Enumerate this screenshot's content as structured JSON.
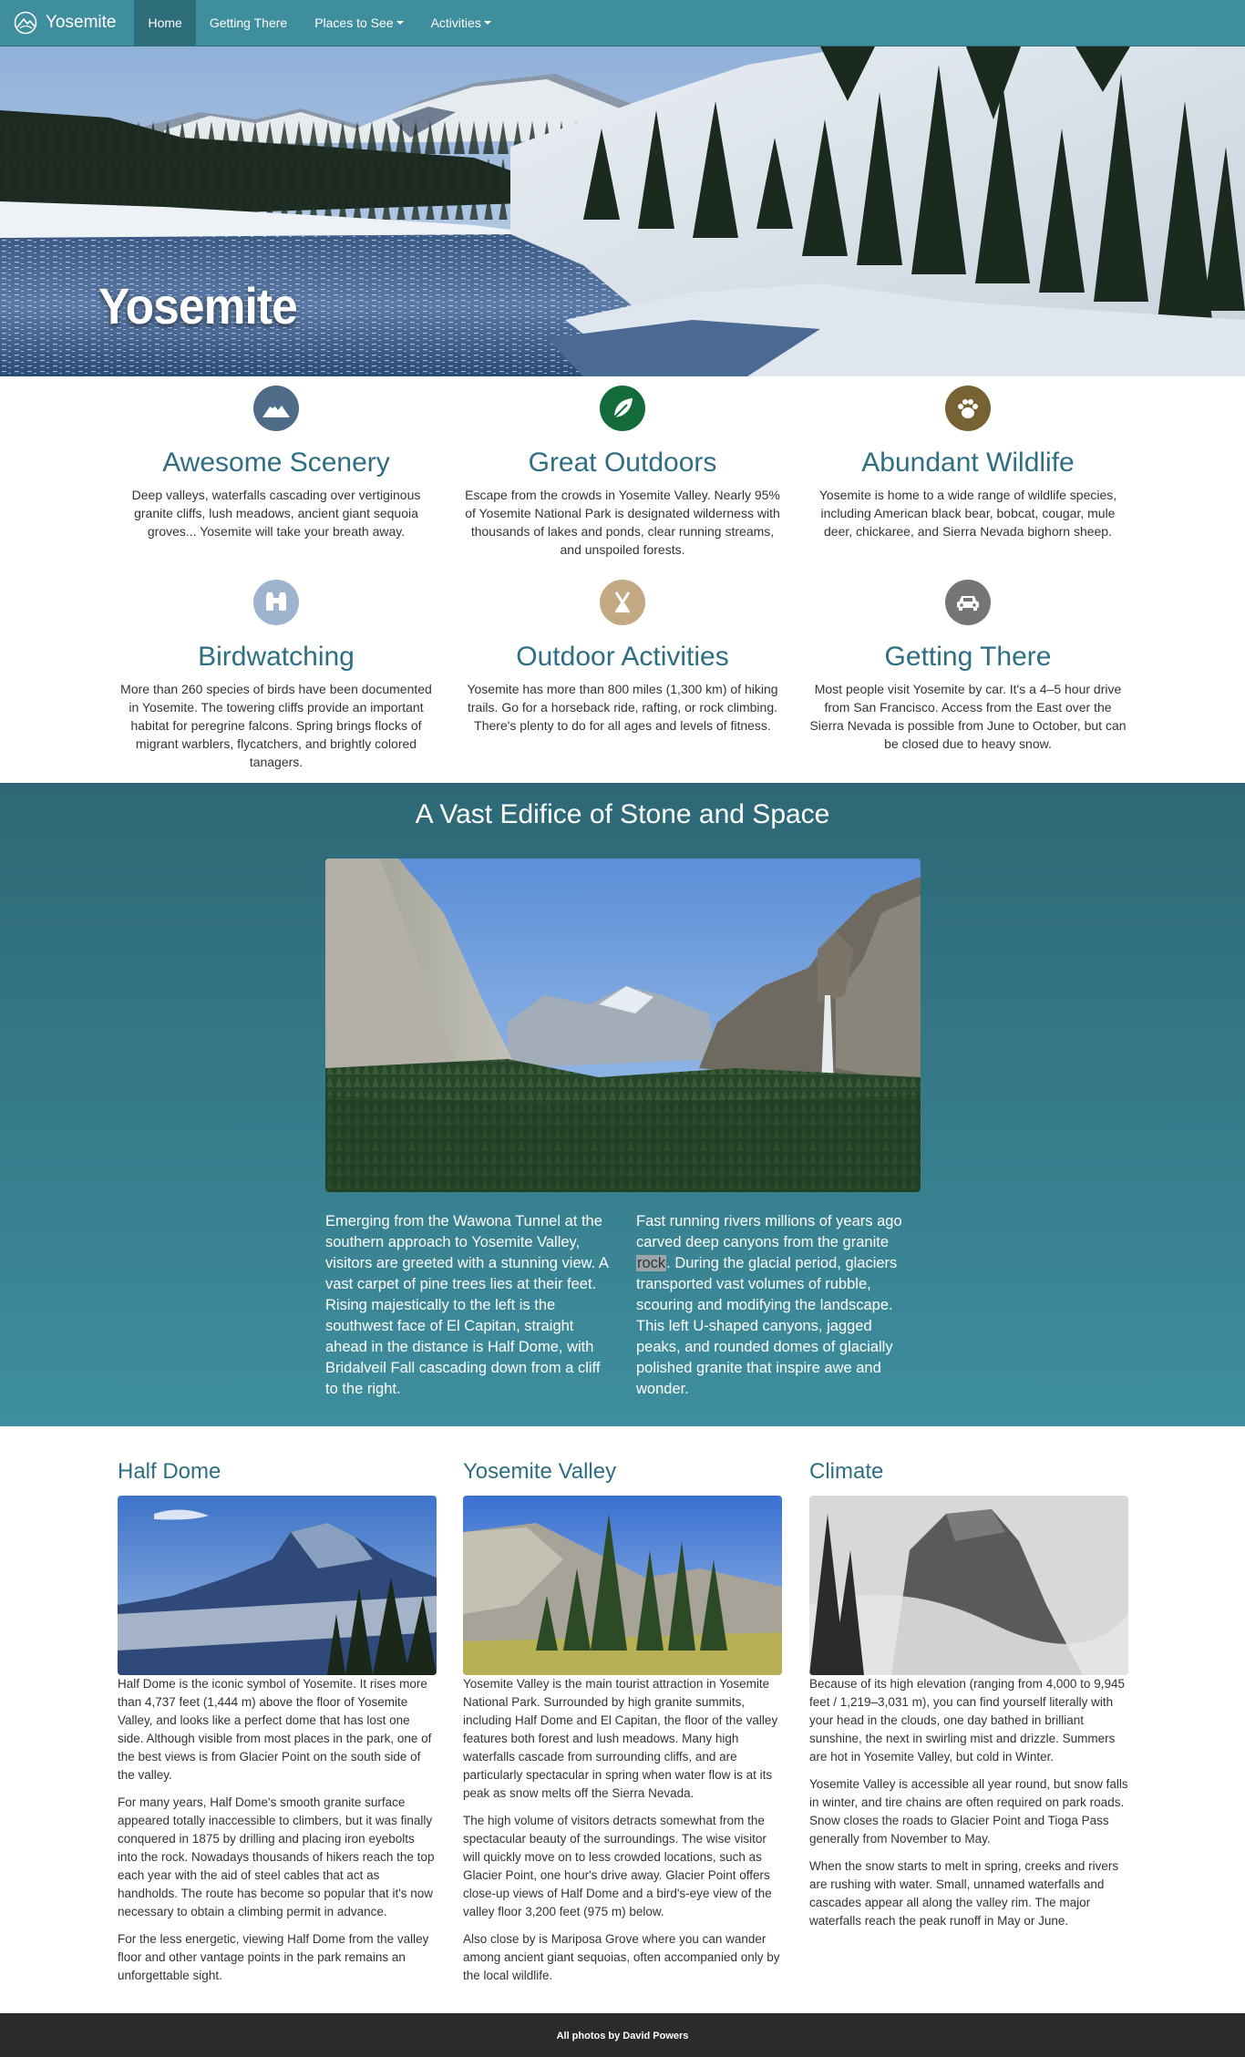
{
  "navbar": {
    "brand": "Yosemite",
    "items": [
      {
        "label": "Home"
      },
      {
        "label": "Getting There"
      },
      {
        "label": "Places to See"
      },
      {
        "label": "Activities"
      }
    ]
  },
  "hero": {
    "title": "Yosemite"
  },
  "features": [
    {
      "icon": "mountain-icon",
      "color": "#4e6c88",
      "title": "Awesome Scenery",
      "text": "Deep valleys, waterfalls cascading over vertiginous granite cliffs, lush meadows, ancient giant sequoia groves... Yosemite will take your breath away."
    },
    {
      "icon": "leaf-icon",
      "color": "#146b3a",
      "title": "Great Outdoors",
      "text": "Escape from the crowds in Yosemite Valley. Nearly 95% of Yosemite National Park is designated wilderness with thousands of lakes and ponds, clear running streams, and unspoiled forests."
    },
    {
      "icon": "paw-icon",
      "color": "#776233",
      "title": "Abundant Wildlife",
      "text": "Yosemite is home to a wide range of wildlife species, including American black bear, bobcat, cougar, mule deer, chickaree, and Sierra Nevada bighorn sheep."
    },
    {
      "icon": "binoculars-icon",
      "color": "#9fb3cf",
      "title": "Birdwatching",
      "text": "More than 260 species of birds have been documented in Yosemite. The towering cliffs provide an important habitat for peregrine falcons. Spring brings flocks of migrant warblers, flycatchers, and brightly colored tanagers."
    },
    {
      "icon": "camping-icon",
      "color": "#c3a884",
      "title": "Outdoor Activities",
      "text": "Yosemite has more than 800 miles (1,300 km) of hiking trails. Go for a horseback ride, rafting, or rock climbing. There's plenty to do for all ages and levels of fitness."
    },
    {
      "icon": "car-icon",
      "color": "#757575",
      "title": "Getting There",
      "text": "Most people visit Yosemite by car. It's a 4–5 hour drive from San Francisco. Access from the East over the Sierra Nevada is possible from June to October, but can be closed due to heavy snow."
    }
  ],
  "edifice": {
    "title": "A Vast Edifice of Stone and Space",
    "left_text": "Emerging from the Wawona Tunnel at the southern approach to Yosemite Valley, visitors are greeted with a stunning view. A vast carpet of pine trees lies at their feet. Rising majestically to the left is the southwest face of El Capitan, straight ahead in the distance is Half Dome, with Bridalveil Fall cascading down from a cliff to the right.",
    "right_text_before": "Fast running rivers millions of years ago carved deep canyons from the granite ",
    "right_text_highlight": "rock",
    "right_text_after": ". During the glacial period, glaciers transported vast volumes of rubble, scouring and modifying the landscape. This left U-shaped canyons, jagged peaks, and rounded domes of glacially polished granite that inspire awe and wonder."
  },
  "columns": [
    {
      "title": "Half Dome",
      "paragraphs": [
        "Half Dome is the iconic symbol of Yosemite. It rises more than 4,737 feet (1,444 m) above the floor of Yosemite Valley, and looks like a perfect dome that has lost one side. Although visible from most places in the park, one of the best views is from Glacier Point on the south side of the valley.",
        "For many years, Half Dome's smooth granite surface appeared totally inaccessible to climbers, but it was finally conquered in 1875 by drilling and placing iron eyebolts into the rock. Nowadays thousands of hikers reach the top each year with the aid of steel cables that act as handholds. The route has become so popular that it's now necessary to obtain a climbing permit in advance.",
        "For the less energetic, viewing Half Dome from the valley floor and other vantage points in the park remains an unforgettable sight."
      ]
    },
    {
      "title": "Yosemite Valley",
      "paragraphs": [
        "Yosemite Valley is the main tourist attraction in Yosemite National Park. Surrounded by high granite summits, including Half Dome and El Capitan, the floor of the valley features both forest and lush meadows. Many high waterfalls cascade from surrounding cliffs, and are particularly spectacular in spring when water flow is at its peak as snow melts off the Sierra Nevada.",
        "The high volume of visitors detracts somewhat from the spectacular beauty of the surroundings. The wise visitor will quickly move on to less crowded locations, such as Glacier Point, one hour's drive away. Glacier Point offers close-up views of Half Dome and a bird's-eye view of the valley floor 3,200 feet (975 m) below.",
        "Also close by is Mariposa Grove where you can wander among ancient giant sequoias, often accompanied only by the local wildlife."
      ]
    },
    {
      "title": "Climate",
      "paragraphs": [
        "Because of its high elevation (ranging from 4,000 to 9,945 feet / 1,219–3,031 m), you can find yourself literally with your head in the clouds, one day bathed in brilliant sunshine, the next in swirling mist and drizzle. Summers are hot in Yosemite Valley, but cold in Winter.",
        "Yosemite Valley is accessible all year round, but snow falls in winter, and tire chains are often required on park roads. Snow closes the roads to Glacier Point and Tioga Pass generally from November to May.",
        "When the snow starts to melt in spring, creeks and rivers are rushing with water. Small, unnamed waterfalls and cascades appear all along the valley rim. The major waterfalls reach the peak runoff in May or June."
      ]
    }
  ],
  "footer": {
    "text": "All photos by David Powers"
  }
}
